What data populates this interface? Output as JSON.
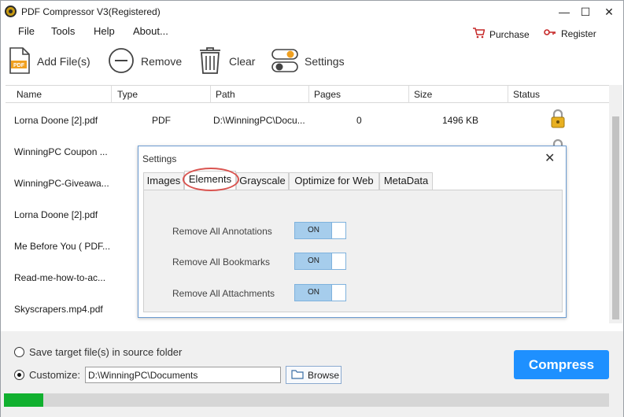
{
  "window": {
    "title": "PDF Compressor V3(Registered)",
    "controls": {
      "minimize": "—",
      "maximize": "☐",
      "close": "✕"
    }
  },
  "menu": {
    "items": [
      "File",
      "Tools",
      "Help",
      "About..."
    ],
    "purchase": "Purchase",
    "register": "Register"
  },
  "toolbar": {
    "add_files": "Add File(s)",
    "remove": "Remove",
    "clear": "Clear",
    "settings": "Settings"
  },
  "table": {
    "columns": [
      "Name",
      "Type",
      "Path",
      "Pages",
      "Size",
      "Status"
    ],
    "rows": [
      {
        "name": "Lorna Doone [2].pdf",
        "type": "PDF",
        "path": "D:\\WinningPC\\Docu...",
        "pages": "0",
        "size": "1496 KB",
        "status_icon": "lock-icon"
      },
      {
        "name": "WinningPC Coupon ...",
        "type": "",
        "path": "",
        "pages": "",
        "size": "",
        "status_icon": "lock-icon"
      },
      {
        "name": "WinningPC-Giveawa...",
        "type": "",
        "path": "",
        "pages": "",
        "size": "",
        "status_icon": ""
      },
      {
        "name": "Lorna Doone [2].pdf",
        "type": "",
        "path": "",
        "pages": "",
        "size": "",
        "status_icon": ""
      },
      {
        "name": "Me Before You ( PDF...",
        "type": "",
        "path": "",
        "pages": "",
        "size": "",
        "status_icon": ""
      },
      {
        "name": "Read-me-how-to-ac...",
        "type": "",
        "path": "",
        "pages": "",
        "size": "",
        "status_icon": ""
      },
      {
        "name": "Skyscrapers.mp4.pdf",
        "type": "",
        "path": "",
        "pages": "",
        "size": "",
        "status_icon": ""
      }
    ]
  },
  "output": {
    "save_source_label": "Save target file(s) in source folder",
    "customize_label": "Customize:",
    "customize_path": "D:\\WinningPC\\Documents",
    "browse_label": "Browse",
    "selected": "customize"
  },
  "compress_label": "Compress",
  "progress": {
    "fraction": 0.065,
    "color": "#11b02f"
  },
  "settings_dialog": {
    "title": "Settings",
    "close": "✕",
    "tabs": [
      "Images",
      "Elements",
      "Grayscale",
      "Optimize for Web",
      "MetaData"
    ],
    "active_tab": "Elements",
    "options": [
      {
        "label": "Remove All Annotations",
        "state": "ON"
      },
      {
        "label": "Remove All Bookmarks",
        "state": "ON"
      },
      {
        "label": "Remove All Attachments",
        "state": "ON"
      }
    ]
  },
  "colors": {
    "accent": "#1e90ff",
    "toggle_on": "#a6cdec",
    "highlight_ring": "#d9534f"
  }
}
